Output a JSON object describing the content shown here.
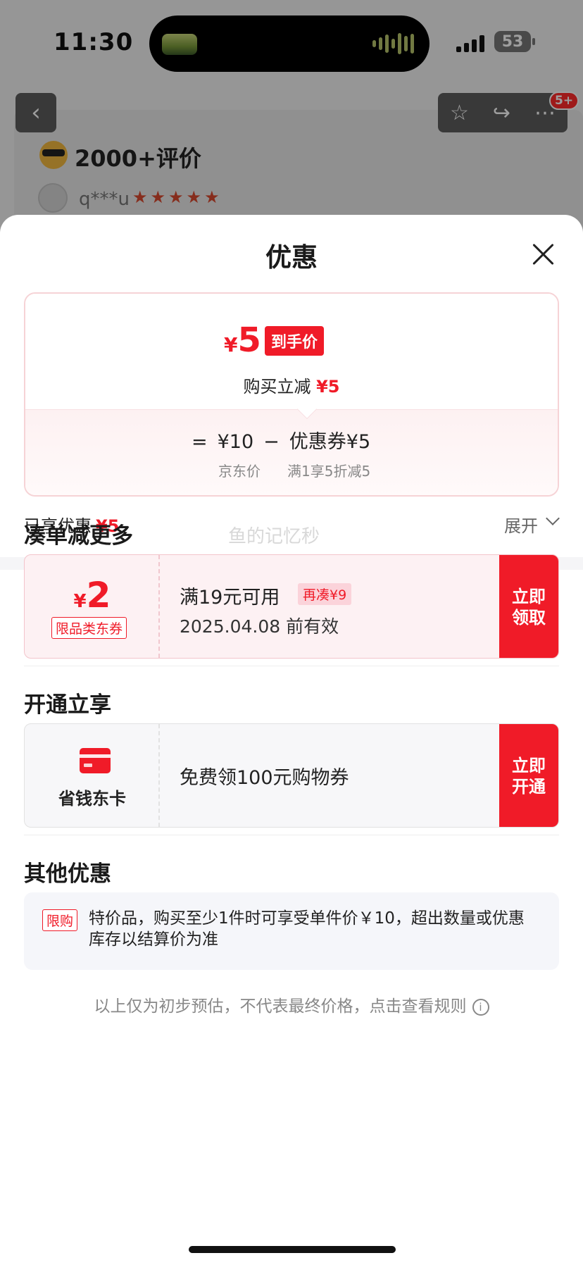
{
  "status": {
    "time": "11:30",
    "battery": "53"
  },
  "background": {
    "review_title": "2000+评价",
    "reviewer": "q***u",
    "stars": [
      "★",
      "★",
      "★",
      "★",
      "★"
    ],
    "notify_badge": "5+"
  },
  "sheet": {
    "title": "优惠",
    "price": {
      "yen": "¥",
      "value": "5",
      "tag": "到手价"
    },
    "discount_line": {
      "text": "购买立减",
      "amount": "¥5"
    },
    "formula": {
      "eq": "=",
      "price": "¥10",
      "minus": "−",
      "coupon": "优惠券¥5"
    },
    "sub_labels": {
      "price_label": "京东价",
      "coupon_rule": "满1享5折减5"
    },
    "enjoyed": {
      "label": "已享优惠",
      "amount": "¥5"
    },
    "expand": "展开"
  },
  "more_section": {
    "title": "凑单减更多",
    "watermark": "鱼的记忆秒",
    "coupon": {
      "yen": "¥",
      "amount": "2",
      "tag": "限品类东券",
      "condition": "满19元可用",
      "more": "再凑¥9",
      "valid": "2025.04.08 前有效",
      "button": "立即领取"
    }
  },
  "open_section": {
    "title": "开通立享",
    "card_name": "省钱东卡",
    "text": "免费领100元购物券",
    "button": "立即开通"
  },
  "other_section": {
    "title": "其他优惠",
    "tag": "限购",
    "text": "特价品，购买至少1件时可享受单件价￥10，超出数量或优惠库存以结算价为准"
  },
  "footnote": "以上仅为初步预估，不代表最终价格，点击查看规则",
  "colors": {
    "accent": "#f01b28",
    "coupon_bg": "#fdf1f3",
    "card_bg": "#f7f7f9"
  }
}
